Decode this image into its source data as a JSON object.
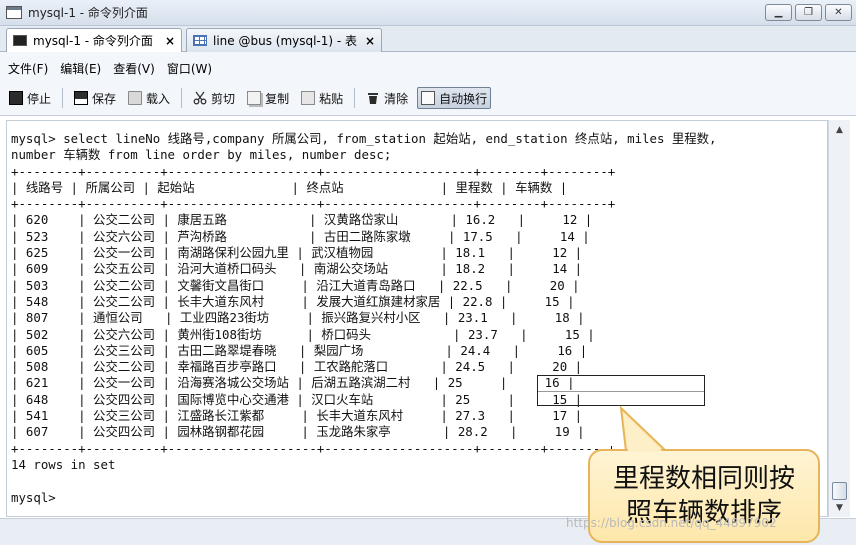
{
  "window": {
    "title": "mysql-1 - 命令列介面"
  },
  "tabs": [
    {
      "label": "mysql-1 - 命令列介面",
      "close": "×"
    },
    {
      "label": "line @bus (mysql-1) - 表",
      "close": "×"
    }
  ],
  "menu": [
    {
      "label": "文件(F)"
    },
    {
      "label": "编辑(E)"
    },
    {
      "label": "查看(V)"
    },
    {
      "label": "窗口(W)"
    }
  ],
  "toolbar": {
    "stop": "停止",
    "save": "保存",
    "load": "载入",
    "cut": "剪切",
    "copy": "复制",
    "paste": "粘贴",
    "clear": "清除",
    "wrap": "自动换行"
  },
  "console": {
    "lines": [
      "mysql> select lineNo 线路号,company 所属公司, from_station 起始站, end_station 终点站, miles 里程数,",
      "number 车辆数 from line order by miles, number desc;",
      "+--------+----------+--------------------+--------------------+--------+--------+",
      "| 线路号 | 所属公司 | 起始站             | 终点站             | 里程数 | 车辆数 |",
      "+--------+----------+--------------------+--------------------+--------+--------+",
      "| 620    | 公交二公司 | 康居五路           | 汉黄路岱家山       | 16.2   |     12 |",
      "| 523    | 公交六公司 | 芦沟桥路           | 古田二路陈家墩     | 17.5   |     14 |",
      "| 625    | 公交一公司 | 南湖路保利公园九里 | 武汉植物园         | 18.1   |     12 |",
      "| 609    | 公交五公司 | 沿河大道桥口码头   | 南湖公交场站       | 18.2   |     14 |",
      "| 503    | 公交二公司 | 文馨街文昌街口     | 沿江大道青岛路口   | 22.5   |     20 |",
      "| 548    | 公交二公司 | 长丰大道东风村     | 发展大道红旗建材家居 | 22.8 |     15 |",
      "| 807    | 通恒公司   | 工业四路23街坊     | 振兴路复兴村小区   | 23.1   |     18 |",
      "| 502    | 公交六公司 | 黄州街108街坊      | 桥口码头           | 23.7   |     15 |",
      "| 605    | 公交三公司 | 古田二路翠堤春晓   | 梨园广场           | 24.4   |     16 |",
      "| 508    | 公交二公司 | 幸福路百步亭路口   | 工农路舵落口       | 24.5   |     20 |",
      "| 621    | 公交一公司 | 沿海赛洛城公交场站 | 后湖五路滨湖二村   | 25     |     16 |",
      "| 648    | 公交四公司 | 国际博览中心交通港 | 汉口火车站         | 25     |     15 |",
      "| 541    | 公交三公司 | 江盛路长江紫都     | 长丰大道东风村     | 27.3   |     17 |",
      "| 607    | 公交四公司 | 园林路钢都花园     | 玉龙路朱家亭       | 28.2   |     19 |",
      "+--------+----------+--------------------+--------------------+--------+--------+",
      "14 rows in set",
      "",
      "mysql>"
    ]
  },
  "callout": {
    "line1": "里程数相同则按",
    "line2": "照车辆数排序"
  },
  "watermark": "https://blog.csdn.net/qq_44897902"
}
